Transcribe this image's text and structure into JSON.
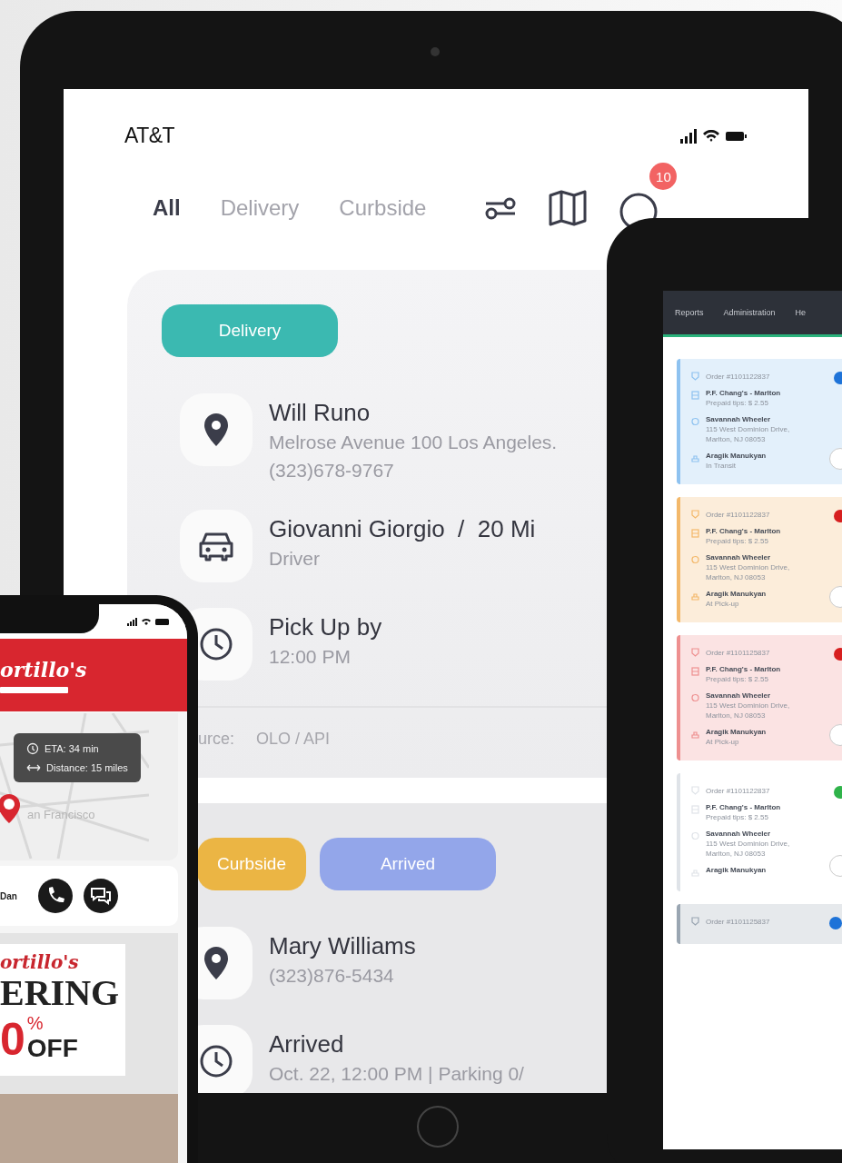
{
  "main_tablet": {
    "status_bar": {
      "carrier": "AT&T"
    },
    "tabs": [
      {
        "label": "All",
        "selected": true
      },
      {
        "label": "Delivery",
        "selected": false
      },
      {
        "label": "Curbside",
        "selected": false
      }
    ],
    "notification_badge": "10",
    "orders": [
      {
        "tags": [
          {
            "label": "Delivery",
            "color": "#3bb9b1"
          }
        ],
        "details": [
          {
            "kind": "location",
            "title": "Will Runo",
            "lines": [
              "Melrose Avenue 100 Los Angeles.",
              "(323)678-9767"
            ]
          },
          {
            "kind": "car",
            "title": "Giovanni Giorgio  /  20 Mi",
            "lines": [
              "Driver"
            ]
          },
          {
            "kind": "clock",
            "title": "Pick Up by",
            "lines": [
              "12:00 PM"
            ]
          }
        ],
        "source_label": "urce:",
        "source_value": "OLO / API"
      },
      {
        "tags": [
          {
            "label": "Curbside",
            "color": "#ebb544"
          },
          {
            "label": "Arrived",
            "color": "#93a6ea"
          }
        ],
        "details": [
          {
            "kind": "location",
            "title": "Mary Williams",
            "lines": [
              "(323)876-5434"
            ]
          },
          {
            "kind": "clock",
            "title": "Arrived",
            "lines": [
              "Oct. 22, 12:00 PM | Parking 0/"
            ]
          }
        ]
      }
    ]
  },
  "phone": {
    "logo": "ortillo's",
    "eta": "ETA: 34 min",
    "distance": "Distance: 15 miles",
    "map_label": "an Francisco",
    "driver_name": "Dan",
    "promo": {
      "brand": "ortillo's",
      "headline": "ERING",
      "discount": "0",
      "percent": "%",
      "off": "OFF"
    }
  },
  "dashboard": {
    "nav": [
      "Reports",
      "Administration",
      "He"
    ],
    "orders": [
      {
        "order": "Order #1101122837",
        "restaurant": "P.F. Chang's - Marlton",
        "tips": "Prepaid tips: $ 2.55",
        "customer": "Savannah Wheeler",
        "address": [
          "115 West Dominion Drive,",
          "Marlton, NJ 08053"
        ],
        "driver": "Aragik Manukyan",
        "status": "In Transit",
        "color": "#8ec2f0",
        "status_dot": {
          "color": "#1e73d8"
        }
      },
      {
        "order": "Order #1101122837",
        "restaurant": "P.F. Chang's - Marlton",
        "tips": "Prepaid tips: $ 2.55",
        "customer": "Savannah Wheeler",
        "address": [
          "115 West Dominion Drive,",
          "Marlton, NJ 08053"
        ],
        "driver": "Aragik Manukyan",
        "status": "At Pick-up",
        "color": "#f3b86a",
        "status_dot": {
          "color": "#d71f1f"
        }
      },
      {
        "order": "Order #1101125837",
        "restaurant": "P.F. Chang's - Marlton",
        "tips": "Prepaid tips: $ 2.55",
        "customer": "Savannah Wheeler",
        "address": [
          "115 West Dominion Drive,",
          "Marlton, NJ 08053"
        ],
        "driver": "Aragik Manukyan",
        "status": "At Pick-up",
        "color": "#ee9090",
        "status_dot": {
          "color": "#d71f1f"
        }
      },
      {
        "order": "Order #1101122837",
        "restaurant": "P.F. Chang's - Marlton",
        "tips": "Prepaid tips: $ 2.55",
        "customer": "Savannah Wheeler",
        "address": [
          "115 West Dominion Drive,",
          "Marlton, NJ 08053"
        ],
        "driver": "Aragik Manukyan",
        "color": "#dfe3e8",
        "status_dot": {
          "color": "#2fb34a"
        }
      },
      {
        "order": "Order #1101125837",
        "color": "#9aa6b2",
        "status_dot": {
          "color": "#1e73d8"
        }
      }
    ]
  }
}
